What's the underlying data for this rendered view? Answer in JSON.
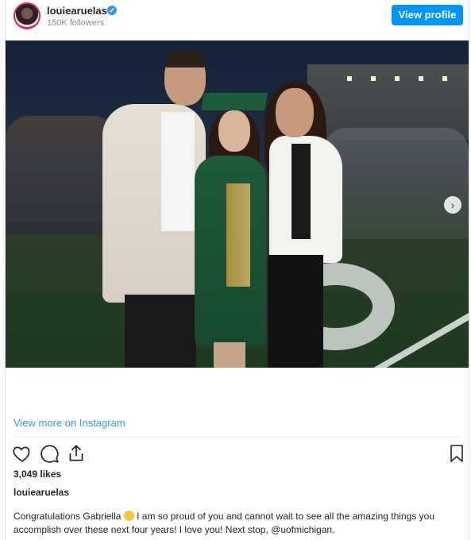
{
  "header": {
    "username": "louiearuelas",
    "followers": "150K followers",
    "view_profile_label": "View profile"
  },
  "post": {
    "carousel_next": "›",
    "view_more_label": "View more on Instagram",
    "likes": "3,049 likes",
    "caption_user": "louiearuelas",
    "caption_before_emoji": "Congratulations Gabriella",
    "caption_after_emoji": " I am so proud of you and cannot wait to see all the amazing things you accomplish over these next four years! I love you! Next stop, ",
    "caption_mention": "@uofmichigan",
    "caption_end": "."
  },
  "icons": [
    "heart-icon",
    "comment-icon",
    "share-icon",
    "bookmark-icon",
    "verified-icon"
  ],
  "colors": {
    "accent": "#0095f6",
    "link": "#3897f0",
    "verified": "#3897f0"
  }
}
